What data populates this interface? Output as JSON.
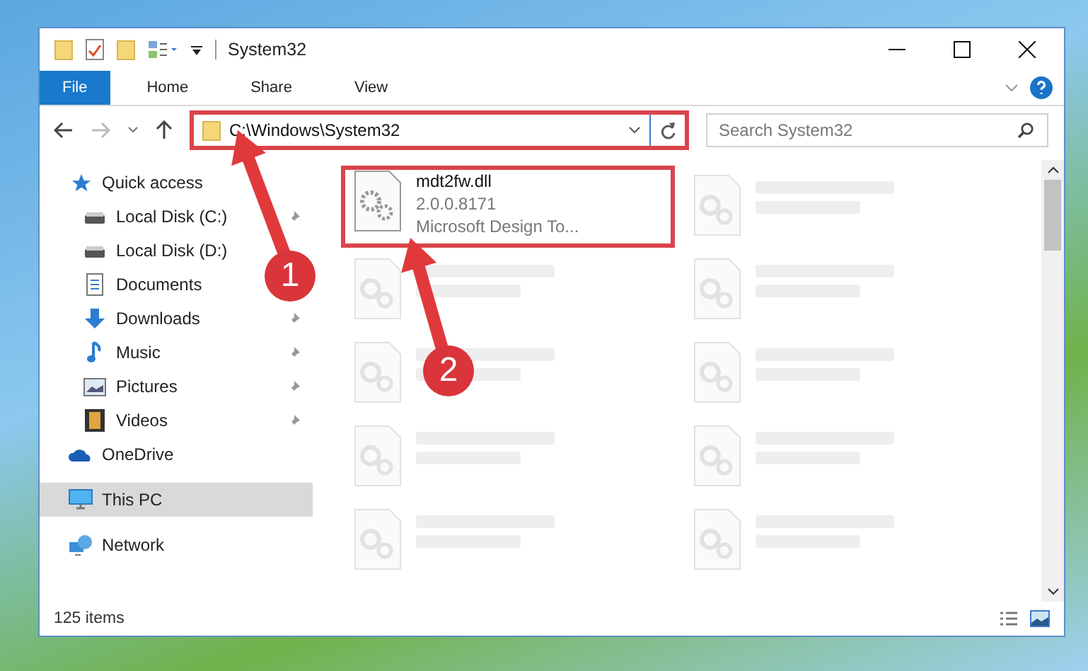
{
  "window": {
    "title": "System32"
  },
  "ribbon": {
    "tabs": [
      {
        "label": "File",
        "selected": true
      },
      {
        "label": "Home",
        "selected": false
      },
      {
        "label": "Share",
        "selected": false
      },
      {
        "label": "View",
        "selected": false
      }
    ]
  },
  "address_bar": {
    "path": "C:\\Windows\\System32",
    "highlight": true
  },
  "search": {
    "placeholder": "Search System32"
  },
  "sidebar": {
    "items": [
      {
        "label": "Quick access",
        "kind": "star",
        "selected": false,
        "children": [
          {
            "label": "Local Disk (C:)",
            "kind": "drive",
            "pinned": true,
            "selected": false
          },
          {
            "label": "Local Disk (D:)",
            "kind": "drive",
            "pinned": false,
            "selected": false
          },
          {
            "label": "Documents",
            "kind": "document",
            "pinned": false,
            "selected": false
          },
          {
            "label": "Downloads",
            "kind": "download",
            "pinned": true,
            "selected": false
          },
          {
            "label": "Music",
            "kind": "music",
            "pinned": true,
            "selected": false
          },
          {
            "label": "Pictures",
            "kind": "picture",
            "pinned": true,
            "selected": false
          },
          {
            "label": "Videos",
            "kind": "video",
            "pinned": true,
            "selected": false
          }
        ]
      },
      {
        "label": "OneDrive",
        "kind": "cloud",
        "selected": false
      },
      {
        "label": "This PC",
        "kind": "pc",
        "selected": true
      },
      {
        "label": "Network",
        "kind": "network",
        "selected": false
      }
    ]
  },
  "files": [
    {
      "name": "mdt2fw.dll",
      "lines": [
        "2.0.0.8171",
        "Microsoft Design To..."
      ],
      "faded": false,
      "highlight": true
    },
    {
      "faded": true
    },
    {
      "faded": true
    },
    {
      "faded": true
    },
    {
      "faded": true
    },
    {
      "faded": true
    },
    {
      "faded": true
    },
    {
      "faded": true
    },
    {
      "faded": true
    },
    {
      "faded": true
    }
  ],
  "status_bar": {
    "count": "125 items"
  },
  "annotations": [
    {
      "label": "1"
    },
    {
      "label": "2"
    }
  ]
}
